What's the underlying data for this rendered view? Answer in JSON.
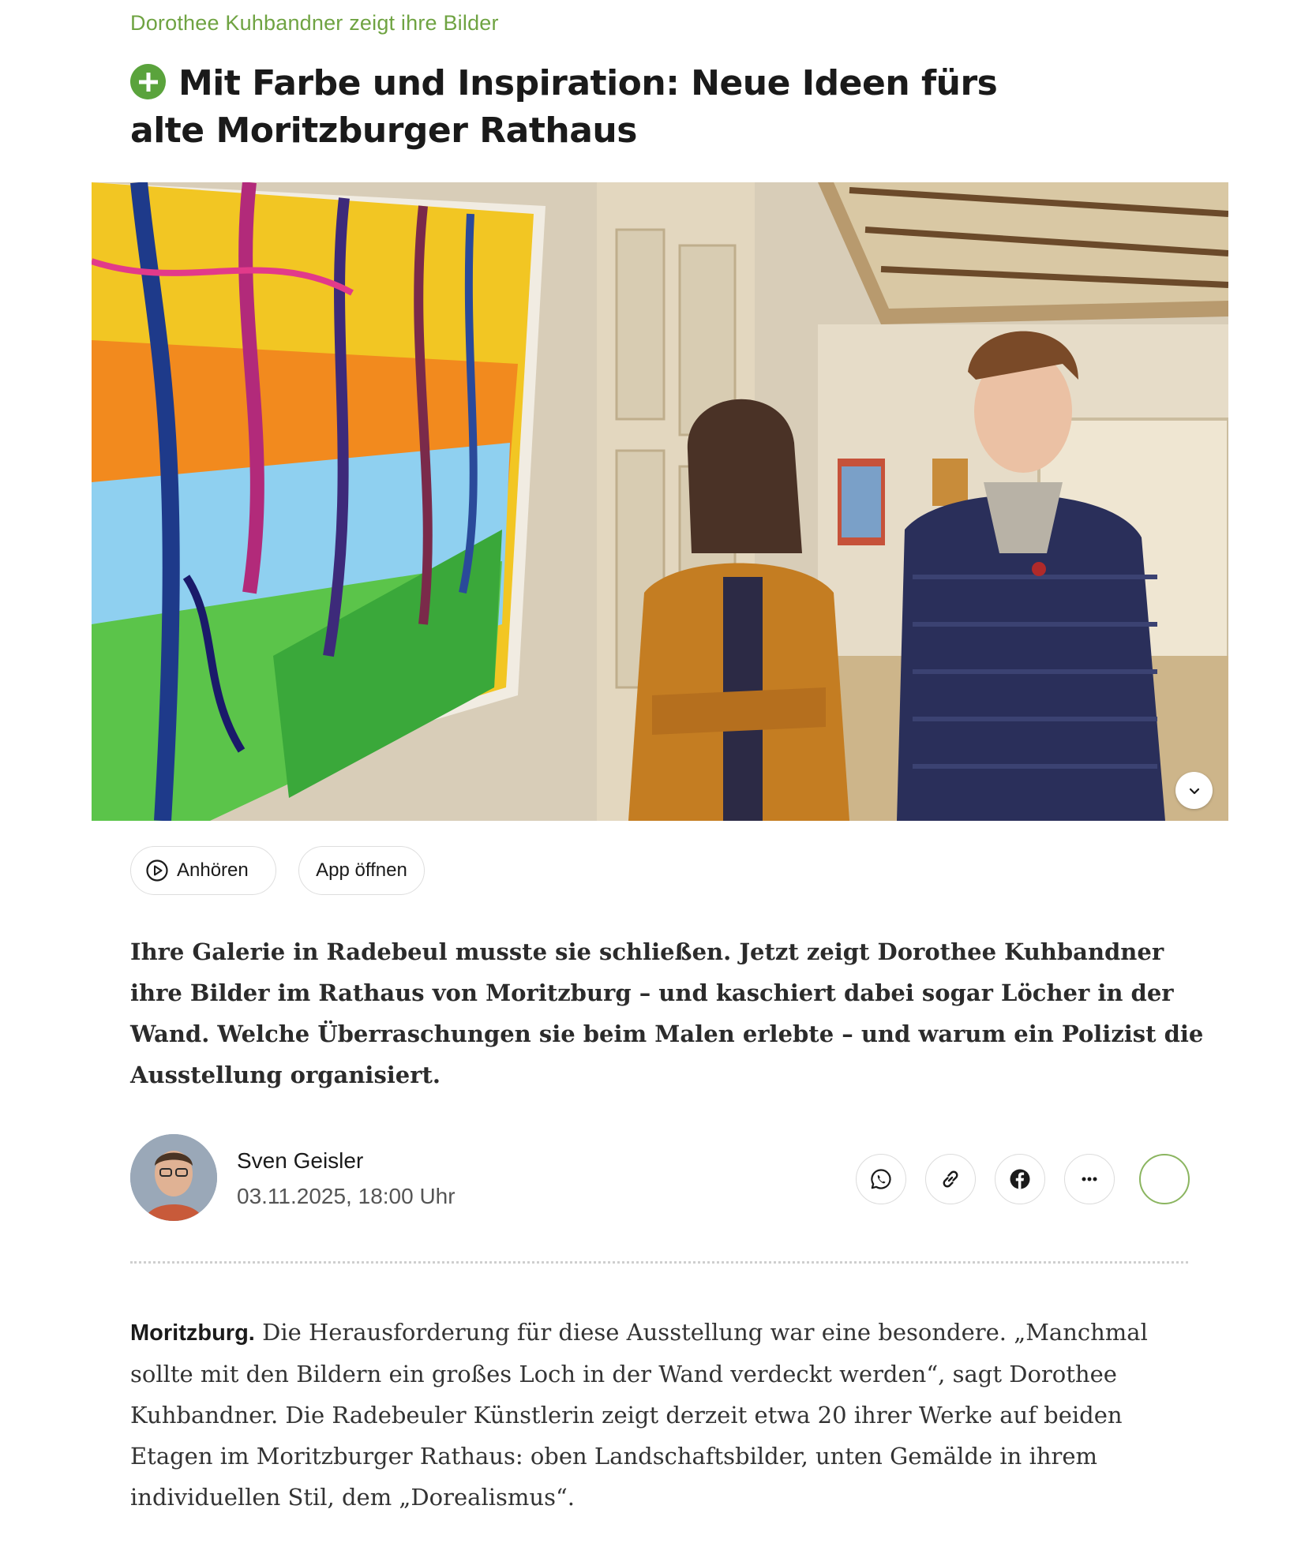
{
  "article": {
    "kicker": "Dorothee Kuhbandner zeigt ihre Bilder",
    "headline": "Mit Farbe und Inspiration: Neue Ideen fürs alte Moritzburger Rathaus",
    "lead": "Ihre Galerie in Radebeul musste sie schließen. Jetzt zeigt Dorothee Kuhbandner ihre Bilder im Rathaus von Moritzburg – und kaschiert dabei sogar Löcher in der Wand. Welche Überraschungen sie beim Malen erlebte – und warum ein Polizist die Ausstellung organisiert.",
    "dateline": "Moritzburg.",
    "body": "Die Herausforderung für diese Ausstellung war eine besondere. „Manchmal sollte mit den Bildern ein großes Loch in der Wand verdeckt werden“, sagt Dorothee Kuhbandner. Die Radebeuler Künstlerin zeigt derzeit etwa 20 ihrer Werke auf beiden Etagen im Moritzburger Rathaus: oben Landschaftsbilder, unten Gemälde in ihrem individuellen Stil, dem „Dorealismus“."
  },
  "actions": {
    "listen_label": "Anhören",
    "app_label": "App öffnen"
  },
  "author": {
    "name": "Sven Geisler",
    "date": "03.11.2025, 18:00 Uhr"
  },
  "icons": {
    "premium": "plus-icon",
    "listen": "play-circle-icon",
    "share": [
      "whatsapp-icon",
      "link-icon",
      "facebook-icon",
      "more-icon"
    ],
    "hero_toggle": "chevron-down-icon"
  },
  "colors": {
    "kicker": "#6fa342",
    "premium_badge": "#5aa33c",
    "bookmark_ring": "#8bb560"
  }
}
